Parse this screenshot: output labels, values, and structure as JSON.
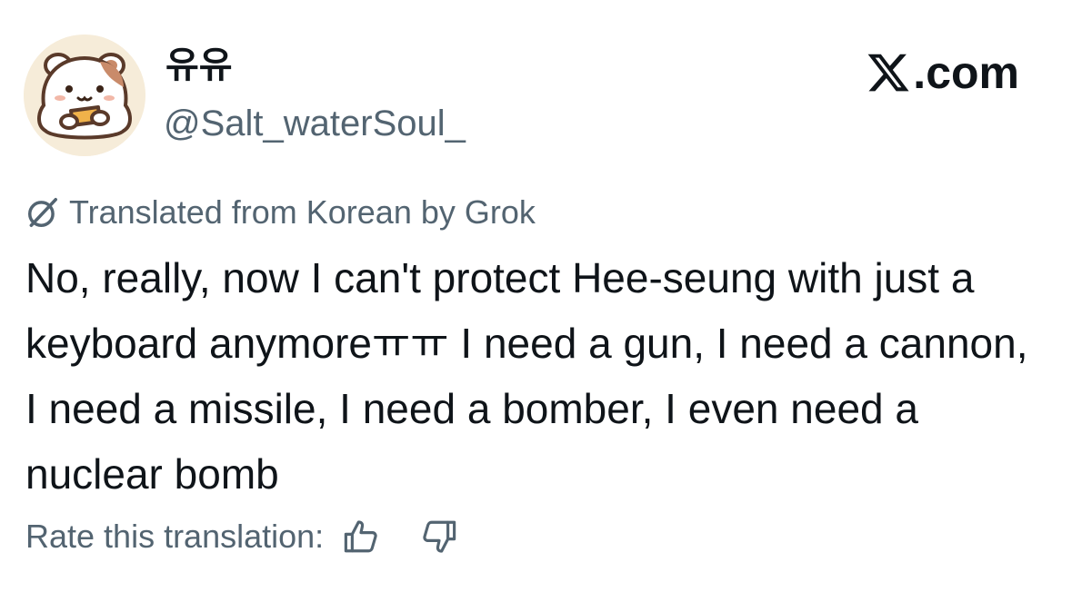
{
  "author": {
    "display_name": "유유",
    "handle": "@Salt_waterSoul_",
    "avatar_icon": "hamster-avatar-icon"
  },
  "brand": {
    "text": ".com",
    "logo_icon": "x-logo-icon"
  },
  "translation": {
    "label": "Translated from Korean by Grok",
    "icon": "grok-icon"
  },
  "tweet": {
    "text": "No, really, now I can't protect Hee-seung with just a keyboard anymoreㅠㅠ I need a gun, I need a cannon, I need a missile, I need a bomber, I even need a nuclear bomb"
  },
  "rating": {
    "label": "Rate this translation:",
    "thumbs_up_icon": "thumbs-up-icon",
    "thumbs_down_icon": "thumbs-down-icon"
  },
  "colors": {
    "text_primary": "#0f1419",
    "text_secondary": "#536471",
    "background": "#ffffff"
  }
}
